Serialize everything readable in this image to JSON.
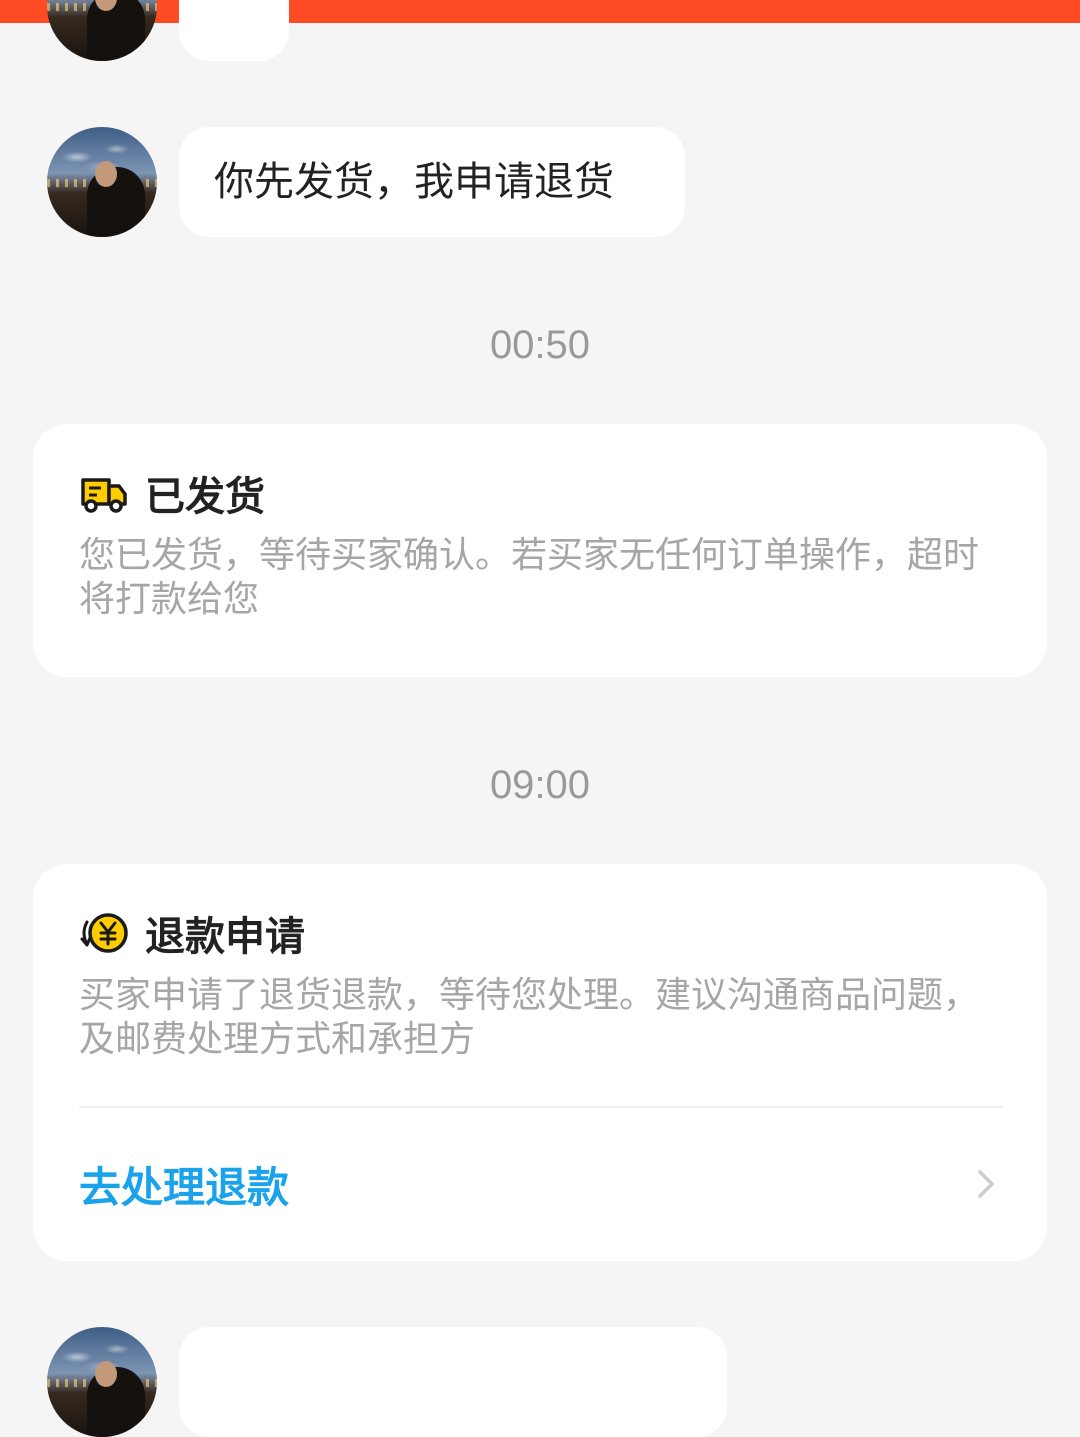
{
  "colors": {
    "top_bar": "#fe4b23",
    "background": "#f5f5f5",
    "link": "#1aa3ea",
    "icon_yellow": "#ffcc00"
  },
  "messages": [
    {
      "text": ""
    },
    {
      "text": "你先发货，我申请退货"
    },
    {
      "text": ""
    }
  ],
  "timestamps": [
    "00:50",
    "09:00"
  ],
  "shipped_card": {
    "icon": "truck-icon",
    "title": "已发货",
    "description": "您已发货，等待买家确认。若买家无任何订单操作，超时将打款给您"
  },
  "refund_card": {
    "icon": "yen-refund-icon",
    "title": "退款申请",
    "description": "买家申请了退货退款，等待您处理。建议沟通商品问题，及邮费处理方式和承担方",
    "action_label": "去处理退款",
    "action_icon": "chevron-right-icon"
  }
}
